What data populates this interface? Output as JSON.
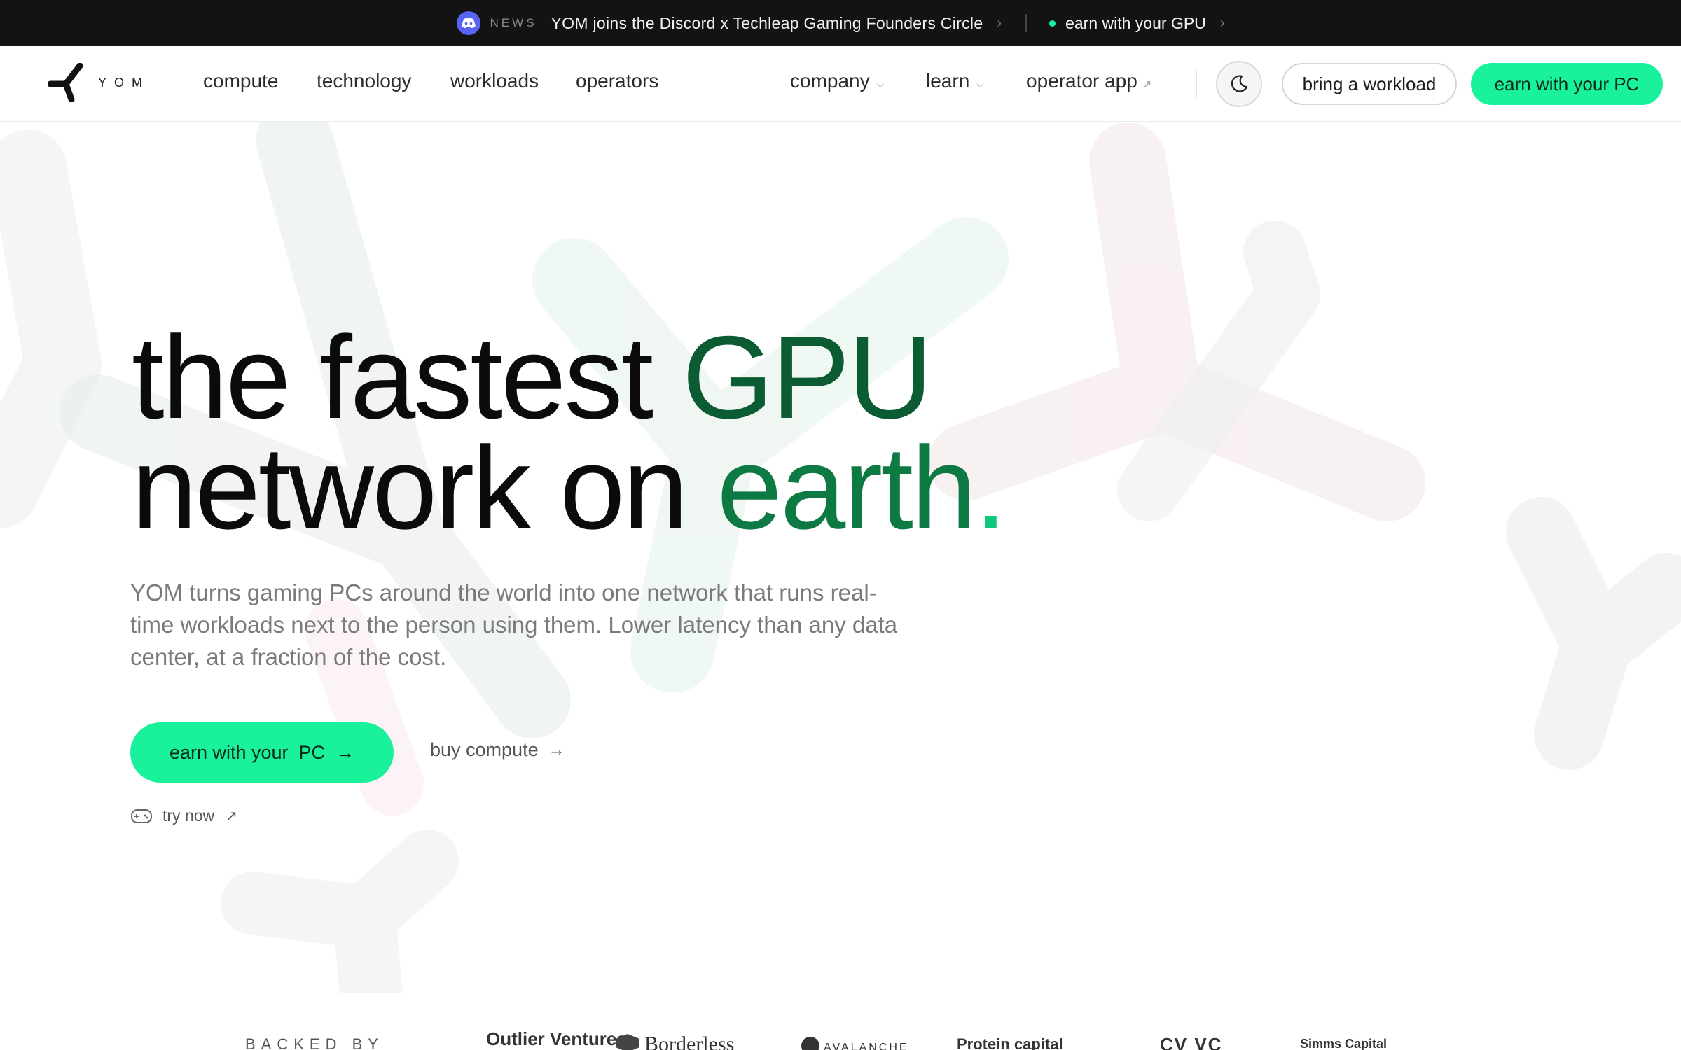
{
  "announcement": {
    "news_label": "NEWS",
    "headline": "YOM joins the Discord x Techleap Gaming Founders Circle",
    "chevron": "›",
    "earn_label": "earn with your GPU",
    "earn_chevron": "›"
  },
  "nav": {
    "brand": "YOM",
    "links": [
      "compute",
      "technology",
      "workloads",
      "operators"
    ],
    "right_links": [
      "company",
      "learn"
    ],
    "external_link": "operator app",
    "bring_workload": "bring a workload",
    "earn_pc": "earn with your PC"
  },
  "hero": {
    "line1_a": "the fastest ",
    "line1_b": "GPU",
    "line2_a": "network on ",
    "line2_b": "earth",
    "line2_dot": ".",
    "subtitle": "YOM turns gaming PCs around the world into one network that runs real-time workloads next to the person using them. Lower latency than any data center, at a fraction of the cost.",
    "cta_primary": "earn with your  PC",
    "cta_secondary": "buy compute",
    "try_now": "try now"
  },
  "backed": {
    "label": "BACKED BY",
    "investors": [
      "Outlier Ventures",
      "Borderless",
      "AVALANCHE",
      "Protein capital",
      "CV VC",
      "Simms Capital"
    ]
  },
  "colors": {
    "accent_green": "#19f29b",
    "dark_green": "#0b5b33",
    "discord": "#5865f2"
  },
  "icons": [
    "discord-icon",
    "yom-logo-icon",
    "moon-icon",
    "gamepad-icon",
    "arrow-right-icon",
    "external-link-icon",
    "chevron-down-icon"
  ]
}
